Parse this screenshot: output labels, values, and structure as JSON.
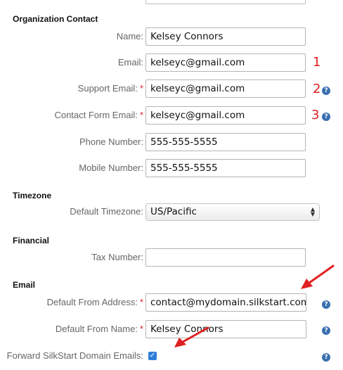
{
  "sections": {
    "organization_contact": "Organization Contact",
    "timezone": "Timezone",
    "financial": "Financial",
    "email": "Email"
  },
  "fields": {
    "name": {
      "label": "Name:",
      "value": "Kelsey Connors"
    },
    "email": {
      "label": "Email:",
      "value": "kelseyc@gmail.com"
    },
    "support_email": {
      "label": "Support Email:",
      "value": "kelseyc@gmail.com"
    },
    "contact_form_email": {
      "label": "Contact Form Email:",
      "value": "kelseyc@gmail.com"
    },
    "phone_number": {
      "label": "Phone Number:",
      "value": "555-555-5555"
    },
    "mobile_number": {
      "label": "Mobile Number:",
      "value": "555-555-5555"
    },
    "default_timezone": {
      "label": "Default Timezone:",
      "value": "US/Pacific"
    },
    "tax_number": {
      "label": "Tax Number:",
      "value": ""
    },
    "default_from_address": {
      "label": "Default From Address:",
      "value": "contact@mydomain.silkstart.com"
    },
    "default_from_name": {
      "label": "Default From Name:",
      "value": "Kelsey Connors"
    },
    "forward_emails": {
      "label": "Forward SilkStart Domain Emails:",
      "checked": true
    }
  },
  "required_mark": "*",
  "annotations": {
    "one": "1",
    "two": "2",
    "three": "3"
  },
  "help_icon": "?",
  "colors": {
    "required": "#d9262a",
    "annotation": "#e02020",
    "help": "#3a6fb0",
    "checkbox": "#2f7fd8"
  }
}
